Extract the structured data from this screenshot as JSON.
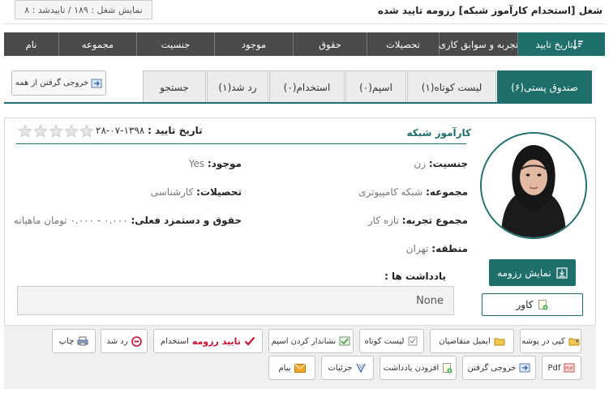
{
  "header": {
    "title": "شغل [استخدام کارآموز شبکه]  رزومه تایید شده",
    "stats": "نمایش شغل : ۱۸۹ / تاییدشد : ۸"
  },
  "sort_bar": {
    "items": [
      "تاریخ تایید",
      "تجربه و سوابق کاری",
      "تحصیلات",
      "حقوق",
      "موجود",
      "جنسیت",
      "مجموعه",
      "نام"
    ]
  },
  "tabs": {
    "items": [
      "صندوق پستی(۶)",
      "لیست کوتاه(۱)",
      "اسپم(۰)",
      "استخدام(۰)",
      "رد شد(۱)",
      "جستجو"
    ],
    "export_all": "خروجی گرفتن از همه"
  },
  "candidate": {
    "job_title": "کارآموز شبکه",
    "approval_label": "تاریخ تایید :",
    "approval_date": "۱۳۹۸-۰۷-۲۸",
    "rating": 0,
    "fields": {
      "gender_label": "جنسیت:",
      "gender_value": "زن",
      "available_label": "موجود:",
      "available_value": "Yes",
      "category_label": "مجموعه:",
      "category_value": "شبکه کامپیوتری",
      "education_label": "تحصیلات:",
      "education_value": "کارشناسی",
      "experience_label": "مجموع تجربه:",
      "experience_value": "تازه کار",
      "salary_label": "حقوق و دستمزد فعلی:",
      "salary_value": "۰.۰۰۰ - ۰.۰۰۰ تومان ماهیانه",
      "region_label": "منطقه:",
      "region_value": "تهران"
    },
    "notes_label": "یادداشت ها :",
    "notes_value": "None",
    "resume_button": "نمایش رزومه",
    "cover_button": "کاور"
  },
  "actions": {
    "row1": [
      "کپی در پوشه",
      "ایمیل متقاضیان",
      "لیست کوتاه",
      "نشاندار کردن اسپم",
      "تایید رزومه",
      "استخدام",
      "رد شد",
      "چاپ"
    ],
    "row2": [
      "Pdf",
      "خروجی گرفتن",
      "افزودن یادداشت",
      "جزئیات",
      "پیام"
    ]
  },
  "colors": {
    "accent": "#1e6f6b",
    "dark_bar": "#4a4a4a",
    "danger": "#c8102e"
  }
}
